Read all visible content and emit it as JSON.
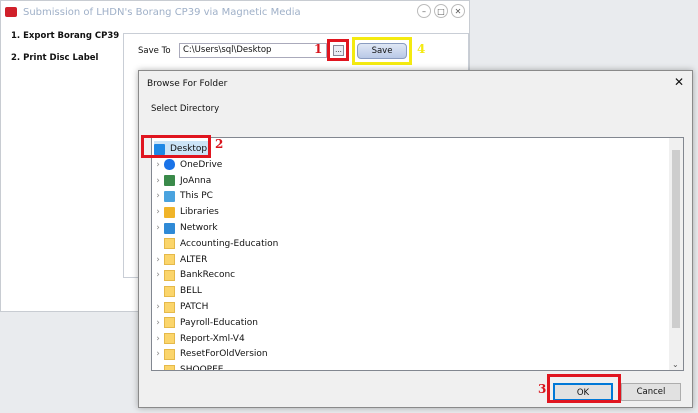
{
  "app": {
    "title": "Submission of LHDN's Borang CP39 via Magnetic Media",
    "nav": [
      "1. Export Borang CP39",
      "2. Print Disc Label"
    ],
    "save_to_label": "Save To",
    "path_value": "C:\\Users\\sql\\Desktop",
    "browse_label": "...",
    "save_label": "Save"
  },
  "dialog": {
    "title": "Browse For Folder",
    "close": "✕",
    "label": "Select Directory",
    "ok": "OK",
    "cancel": "Cancel",
    "items": [
      {
        "label": "Desktop",
        "icon": "desktop-icon",
        "expand": false,
        "selected": true
      },
      {
        "label": "OneDrive",
        "icon": "cloud-icon",
        "expand": true
      },
      {
        "label": "JoAnna",
        "icon": "user-icon",
        "expand": true
      },
      {
        "label": "This PC",
        "icon": "computer-icon",
        "expand": true
      },
      {
        "label": "Libraries",
        "icon": "library-icon",
        "expand": true
      },
      {
        "label": "Network",
        "icon": "network-icon",
        "expand": true
      },
      {
        "label": "Accounting-Education",
        "icon": "folder-icon",
        "expand": false
      },
      {
        "label": "ALTER",
        "icon": "folder-icon",
        "expand": true
      },
      {
        "label": "BankReconc",
        "icon": "folder-icon",
        "expand": true
      },
      {
        "label": "BELL",
        "icon": "folder-icon",
        "expand": false
      },
      {
        "label": "PATCH",
        "icon": "folder-icon",
        "expand": true
      },
      {
        "label": "Payroll-Education",
        "icon": "folder-icon",
        "expand": true
      },
      {
        "label": "Report-Xml-V4",
        "icon": "folder-icon",
        "expand": true
      },
      {
        "label": "ResetForOldVersion",
        "icon": "folder-icon",
        "expand": true
      },
      {
        "label": "SHOOPEE",
        "icon": "folder-icon",
        "expand": false
      }
    ]
  },
  "annotations": {
    "n1": "1",
    "n2": "2",
    "n3": "3",
    "n4": "4",
    "red": "#e0151f",
    "yellow": "#f4ea10"
  }
}
